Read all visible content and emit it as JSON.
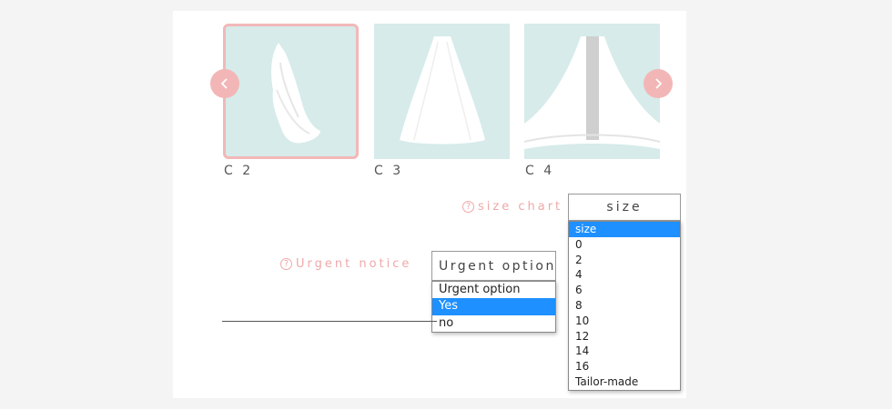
{
  "colors": {
    "thumb_bg": "#d6ebea",
    "accent_pink": "#f3b6b6",
    "highlight": "#1e90ff"
  },
  "carousel": {
    "items": [
      {
        "label": "C 2",
        "selected": true
      },
      {
        "label": "C 3",
        "selected": false
      },
      {
        "label": "C 4",
        "selected": false
      }
    ],
    "prev_icon": "chevron-left-icon",
    "next_icon": "chevron-right-icon"
  },
  "size": {
    "help_label": "size chart",
    "help_icon": "question-icon",
    "value": "size",
    "options": [
      "size",
      "0",
      "2",
      "4",
      "6",
      "8",
      "10",
      "12",
      "14",
      "16",
      "Tailor-made"
    ],
    "highlighted": "size"
  },
  "urgent": {
    "help_label": "Urgent notice",
    "help_icon": "question-icon",
    "value": "Urgent option",
    "options": [
      "Urgent option",
      "Yes",
      "no"
    ],
    "highlighted": "Yes"
  }
}
